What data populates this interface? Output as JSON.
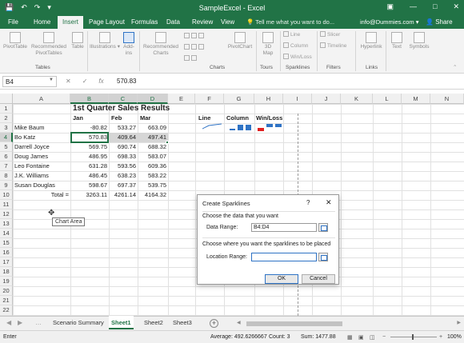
{
  "app": {
    "title": "SampleExcel - Excel",
    "tabs": [
      "File",
      "Home",
      "Insert",
      "Page Layout",
      "Formulas",
      "Data",
      "Review",
      "View"
    ],
    "active_tab": "Insert",
    "tell_me": "Tell me what you want to do...",
    "account": "info@Dummies.com",
    "share": "Share"
  },
  "ribbon": {
    "pivottable": "PivotTable",
    "recommended_pivottables": "Recommended PivotTables",
    "table": "Table",
    "illustrations": "Illustrations",
    "addins": "Add-ins",
    "recommended_charts": "Recommended Charts",
    "pivotchart": "PivotChart",
    "map3d": "3D Map",
    "spark_line": "Line",
    "spark_column": "Column",
    "spark_winloss": "Win/Loss",
    "slicer": "Slicer",
    "timeline": "Timeline",
    "hyperlink": "Hyperlink",
    "text": "Text",
    "symbols": "Symbols",
    "groups": {
      "tables": "Tables",
      "charts": "Charts",
      "tours": "Tours",
      "sparklines": "Sparklines",
      "filters": "Filters",
      "links": "Links"
    }
  },
  "formula_bar": {
    "name_box": "B4",
    "cancel": "✕",
    "enter": "✓",
    "fx": "fx",
    "value": "570.83"
  },
  "columns": [
    "A",
    "B",
    "C",
    "D",
    "E",
    "F",
    "G",
    "H",
    "I",
    "J",
    "K",
    "L",
    "M",
    "N"
  ],
  "rows": [
    "1",
    "2",
    "3",
    "4",
    "5",
    "6",
    "7",
    "8",
    "9",
    "10",
    "11",
    "12",
    "13",
    "14",
    "15",
    "16",
    "17",
    "18",
    "19",
    "20",
    "21",
    "22"
  ],
  "sheet": {
    "title": "1st Quarter Sales Results",
    "headers": [
      "Jan",
      "Feb",
      "Mar"
    ],
    "data": [
      {
        "name": "Mike Baum",
        "values": [
          "-80.82",
          "533.27",
          "663.09"
        ]
      },
      {
        "name": "Bo Katz",
        "values": [
          "570.83",
          "409.64",
          "497.41"
        ]
      },
      {
        "name": "Darrell Joyce",
        "values": [
          "569.75",
          "690.74",
          "688.32"
        ]
      },
      {
        "name": "Doug James",
        "values": [
          "486.95",
          "698.33",
          "583.07"
        ]
      },
      {
        "name": "Leo Fontaine",
        "values": [
          "631.28",
          "593.56",
          "609.36"
        ]
      },
      {
        "name": "J.K. Williams",
        "values": [
          "486.45",
          "638.23",
          "583.22"
        ]
      },
      {
        "name": "Susan Douglas",
        "values": [
          "598.67",
          "697.37",
          "539.75"
        ]
      }
    ],
    "total_label": "Total =",
    "totals": [
      "3263.11",
      "4261.14",
      "4164.32"
    ],
    "spark_headers": [
      "Line",
      "Column",
      "Win/Loss"
    ]
  },
  "tooltip": "Chart Area",
  "dialog": {
    "title": "Create Sparklines",
    "help": "?",
    "close": "✕",
    "section1": "Choose the data that you want",
    "data_range_label": "Data Range:",
    "data_range_value": "B4:D4",
    "section2": "Choose where you want the sparklines to be placed",
    "location_label": "Location Range:",
    "location_value": "",
    "ok": "OK",
    "cancel": "Cancel"
  },
  "sheet_tabs": [
    "Scenario Summary",
    "Sheet1",
    "Sheet2",
    "Sheet3"
  ],
  "active_sheet": "Sheet1",
  "status": {
    "mode": "Enter",
    "average": "Average: 492.6266667",
    "count": "Count: 3",
    "sum": "Sum: 1477.88",
    "zoom": "100%"
  },
  "colors": {
    "excel_green": "#217346",
    "sparkline_blue": "#2f73c5",
    "negative_red": "#e02020"
  }
}
